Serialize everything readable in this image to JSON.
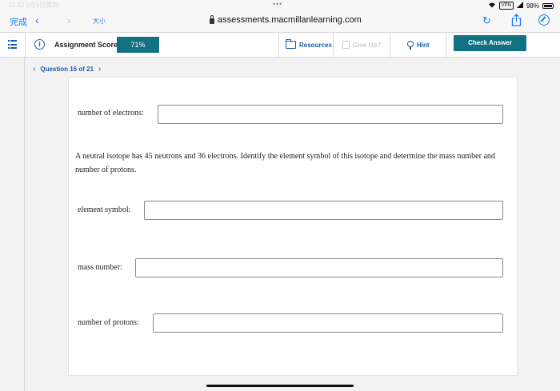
{
  "status_bar": {
    "time": "10:32 9月9日周四",
    "dots": "•••",
    "vpn": "VPN",
    "battery": "98%"
  },
  "browser": {
    "done_label": "完成",
    "back_icon": "chevron-left",
    "forward_icon": "chevron-right",
    "text_size_label": "大小",
    "url": "assessments.macmillanlearning.com"
  },
  "header": {
    "assignment_score_label": "Assignment Score:",
    "score_value": "71%",
    "resources_label": "Resources",
    "give_up_label": "Give Up?",
    "hint_label": "Hint",
    "check_answer_label": "Check Answer"
  },
  "question_nav": {
    "label": "Question 16 of 21"
  },
  "content": {
    "fields_top": [
      {
        "label": "number of electrons:",
        "value": ""
      }
    ],
    "question_text": "A neutral isotope has 45 neutrons and 36 electrons. Identify the element symbol of this isotope and determine the mass number and number of protons.",
    "fields": [
      {
        "label": "element symbol:",
        "value": ""
      },
      {
        "label": "mass number:",
        "value": ""
      },
      {
        "label": "number of protons:",
        "value": ""
      }
    ]
  },
  "colors": {
    "accent_teal": "#127282",
    "link_blue": "#1b5ea8",
    "ios_blue": "#1a7cf0"
  }
}
